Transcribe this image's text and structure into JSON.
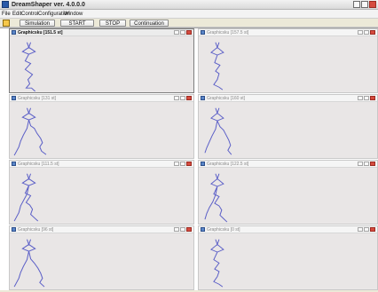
{
  "app": {
    "title": "DreamShaper ver. 4.0.0.0"
  },
  "menu": {
    "items": [
      "File",
      "Edit",
      "Control",
      "Configuration",
      "Window"
    ]
  },
  "toolbar": {
    "buttons": [
      "Simulation",
      "START",
      "STOP",
      "Continuation"
    ]
  },
  "panels": [
    {
      "title": "Graphicsku [151.5 st]"
    },
    {
      "title": "Graphicsku [157.5 st]"
    },
    {
      "title": "Graphicsku [131 st]"
    },
    {
      "title": "Graphicsku [160 st]"
    },
    {
      "title": "Graphicsku [111.5 st]"
    },
    {
      "title": "Graphicsku [122.5 st]"
    },
    {
      "title": "Graphicsku [96 st]"
    },
    {
      "title": "Graphicsku [0 st]"
    }
  ]
}
